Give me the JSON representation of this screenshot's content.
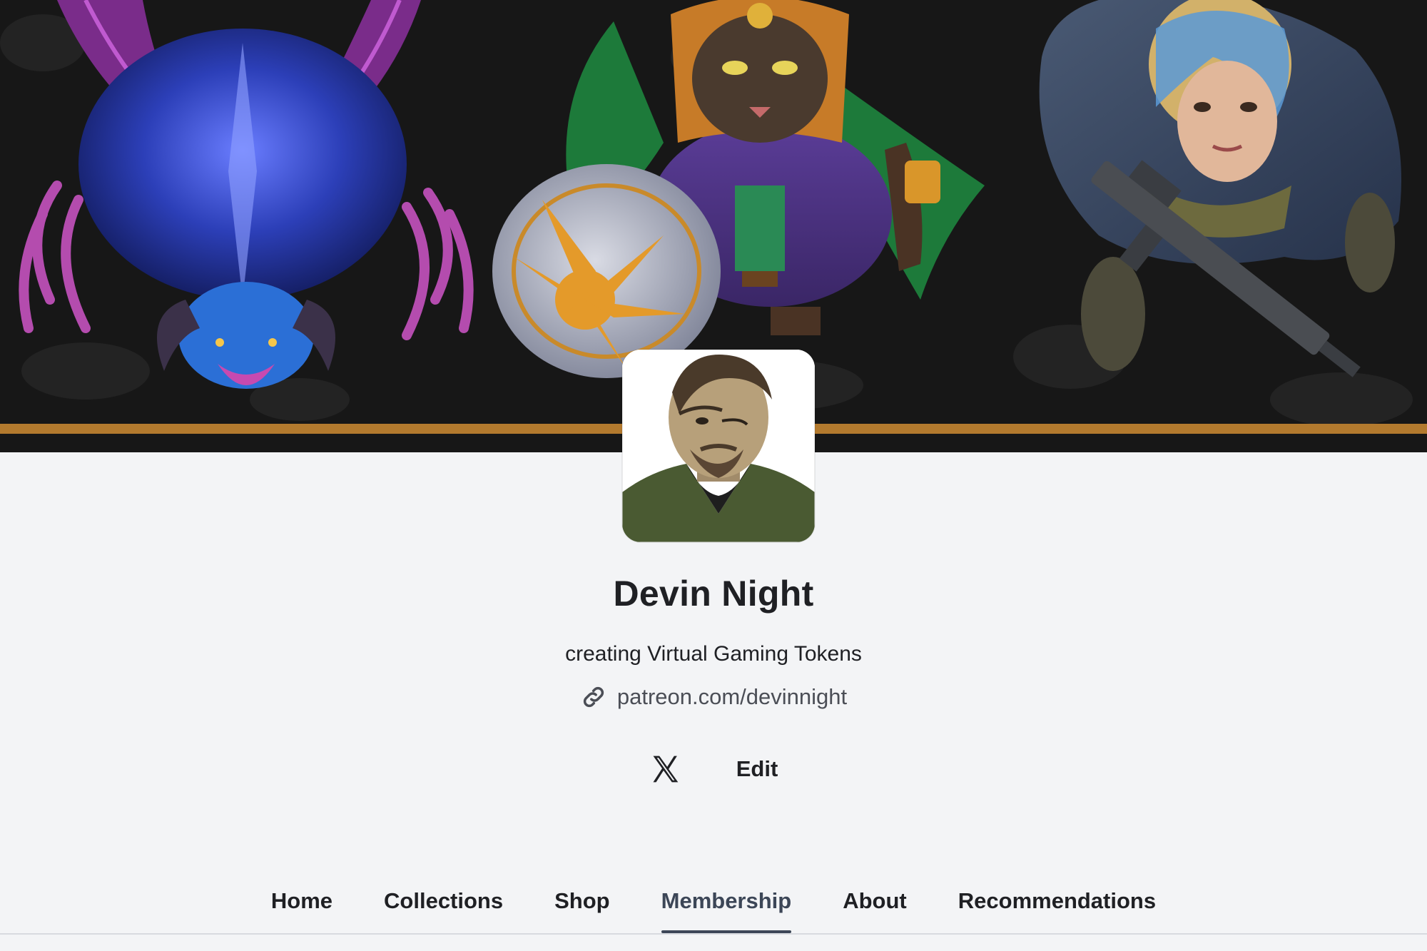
{
  "banner": {
    "description_icon": "fantasy-token-art-banner"
  },
  "creator": {
    "name": "Devin Night",
    "tagline": "creating Virtual Gaming Tokens",
    "link": "patreon.com/devinnight",
    "link_icon": "link-icon",
    "avatar_icon": "creator-avatar-portrait"
  },
  "social": {
    "x_icon": "x-twitter-icon",
    "edit_label": "Edit"
  },
  "nav": {
    "tabs": [
      {
        "label": "Home",
        "active": false
      },
      {
        "label": "Collections",
        "active": false
      },
      {
        "label": "Shop",
        "active": false
      },
      {
        "label": "Membership",
        "active": true
      },
      {
        "label": "About",
        "active": false
      },
      {
        "label": "Recommendations",
        "active": false
      }
    ]
  },
  "colors": {
    "page_background": "#f3f4f6",
    "banner_background": "#181818",
    "banner_stripe": "#b37a2e",
    "active_tab": "#3c4657",
    "text_primary": "#1f2024",
    "text_secondary": "#4b4e56"
  }
}
